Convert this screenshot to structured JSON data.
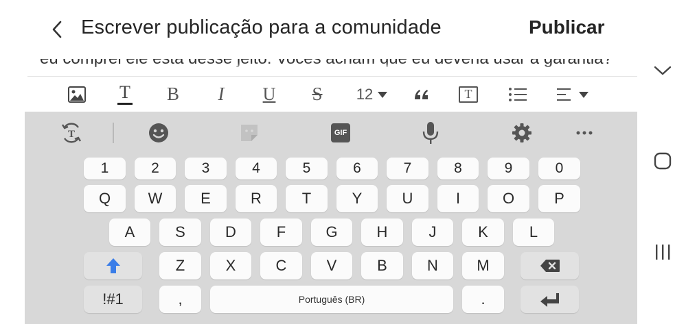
{
  "header": {
    "title": "Escrever publicação para a comunidade",
    "publish_label": "Publicar"
  },
  "editor": {
    "partial_text": "eu comprei ele está desse jeito. Vocês acham que eu deveria usar a garantia?"
  },
  "format_toolbar": {
    "items": [
      "image-icon",
      "text-color-icon",
      "bold-icon",
      "italic-icon",
      "underline-icon",
      "strikethrough-icon",
      "font-size",
      "quote-icon",
      "textbox-icon",
      "bullet-list-icon",
      "align-icon"
    ],
    "bold_label": "B",
    "italic_label": "I",
    "underline_label": "U",
    "strike_label": "S",
    "text_color_label": "T",
    "font_size": "12",
    "textbox_label": "T"
  },
  "keyboard_toolbar": {
    "items": [
      "translate-icon",
      "emoji-icon",
      "sticker-icon",
      "gif-icon",
      "microphone-icon",
      "settings-icon",
      "more-icon"
    ],
    "gif_label": "GIF"
  },
  "keyboard": {
    "number_row": [
      "1",
      "2",
      "3",
      "4",
      "5",
      "6",
      "7",
      "8",
      "9",
      "0"
    ],
    "row1": [
      "Q",
      "W",
      "E",
      "R",
      "T",
      "Y",
      "U",
      "I",
      "O",
      "P"
    ],
    "row2": [
      "A",
      "S",
      "D",
      "F",
      "G",
      "H",
      "J",
      "K",
      "L"
    ],
    "row3": [
      "Z",
      "X",
      "C",
      "V",
      "B",
      "N",
      "M"
    ],
    "symbols_label": "!#1",
    "comma_label": ",",
    "space_label": "Português (BR)",
    "period_label": "."
  },
  "colors": {
    "shift_accent": "#3a7de8",
    "keyboard_bg": "#d8d8d8",
    "key_bg": "#fbfbfb"
  }
}
